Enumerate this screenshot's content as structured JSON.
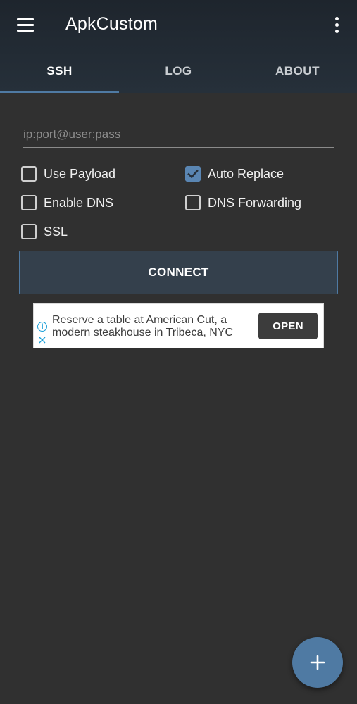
{
  "app": {
    "title": "ApkCustom"
  },
  "tabs": [
    {
      "label": "SSH",
      "active": true
    },
    {
      "label": "LOG",
      "active": false
    },
    {
      "label": "ABOUT",
      "active": false
    }
  ],
  "ssh": {
    "server_input": {
      "value": "",
      "placeholder": "ip:port@user:pass"
    },
    "options": [
      {
        "label": "Use Payload",
        "checked": false
      },
      {
        "label": "Auto Replace",
        "checked": true
      },
      {
        "label": "Enable DNS",
        "checked": false
      },
      {
        "label": "DNS Forwarding",
        "checked": false
      },
      {
        "label": "SSL",
        "checked": false
      }
    ],
    "connect_label": "CONNECT"
  },
  "ad": {
    "text": "Reserve a table at American Cut, a modern steakhouse in Tribeca, NYC",
    "button_label": "OPEN"
  },
  "icons": {
    "menu": "menu-icon",
    "overflow": "more-vert-icon",
    "fab": "plus-icon",
    "ad_info": "info-icon",
    "ad_close": "close-icon"
  },
  "colors": {
    "background": "#303030",
    "appbar": "#222a33",
    "accent": "#4f7aa3",
    "checkbox_checked": "#5a86b3"
  }
}
